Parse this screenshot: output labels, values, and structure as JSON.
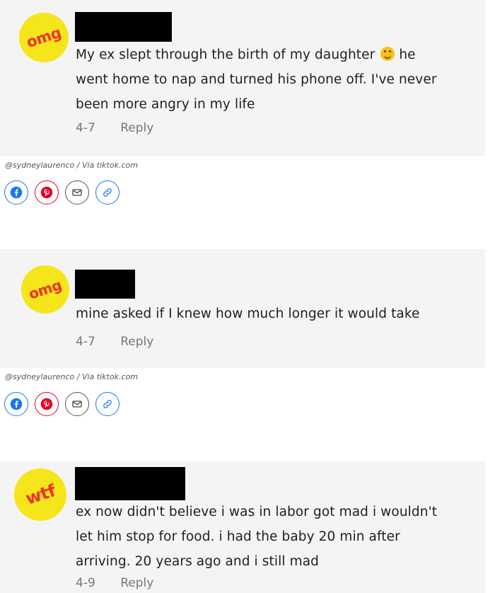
{
  "comments": [
    {
      "badge": "omg",
      "text_lines": [
        "My ex slept through the birth of my daughter",
        "went home to nap and turned his phone off. I've never",
        "been more angry in my life"
      ],
      "text_after_emoji": "he",
      "emoji": "upside-down-face-icon",
      "date": "4-7",
      "reply_label": "Reply"
    },
    {
      "badge": "omg",
      "text_lines": [
        "mine asked if I knew how much longer it would take"
      ],
      "date": "4-7",
      "reply_label": "Reply"
    },
    {
      "badge": "wtf",
      "text_lines": [
        "ex now didn't believe i was in labor got mad i wouldn't",
        "let him stop for food. i had the baby 20 min after",
        "arriving. 20 years ago and i still mad"
      ],
      "date": "4-9",
      "reply_label": "Reply"
    }
  ],
  "credits": [
    "@sydneylaurenco / Via tiktok.com",
    "@sydneylaurenco / Via tiktok.com"
  ],
  "share_buttons": [
    "facebook-icon",
    "pinterest-icon",
    "email-icon",
    "link-icon"
  ],
  "colors": {
    "badge_bg": "#f5e51b",
    "badge_text": "#ee3322",
    "card_bg": "#f4f4f4",
    "facebook": "#1877f2",
    "pinterest": "#e60023"
  }
}
